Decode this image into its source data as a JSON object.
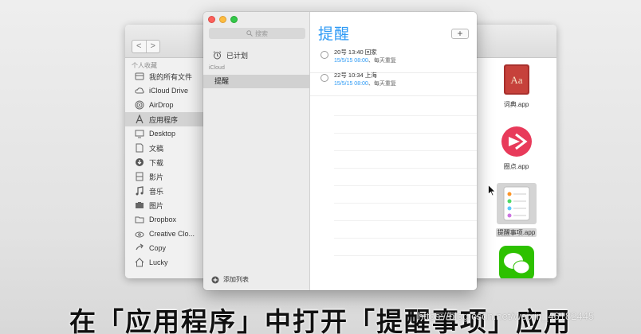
{
  "finder": {
    "nav_back": "<",
    "nav_forward": ">",
    "sidebar_header": "个人收藏",
    "sidebar_items": [
      {
        "label": "我的所有文件",
        "icon": "all-files-icon"
      },
      {
        "label": "iCloud Drive",
        "icon": "cloud-icon"
      },
      {
        "label": "AirDrop",
        "icon": "airdrop-icon"
      },
      {
        "label": "应用程序",
        "icon": "applications-icon",
        "selected": true
      },
      {
        "label": "Desktop",
        "icon": "desktop-icon"
      },
      {
        "label": "文稿",
        "icon": "documents-icon"
      },
      {
        "label": "下载",
        "icon": "download-icon"
      },
      {
        "label": "影片",
        "icon": "movies-icon"
      },
      {
        "label": "音乐",
        "icon": "music-icon"
      },
      {
        "label": "图片",
        "icon": "pictures-icon"
      },
      {
        "label": "Dropbox",
        "icon": "folder-icon"
      },
      {
        "label": "Creative Clo...",
        "icon": "creative-cloud-icon"
      },
      {
        "label": "Copy",
        "icon": "copy-icon"
      },
      {
        "label": "Lucky",
        "icon": "home-icon"
      }
    ],
    "apps": [
      {
        "label": "词典.app",
        "icon": "dictionary-app-icon"
      },
      {
        "label": "圈点.app",
        "icon": "skitch-app-icon"
      },
      {
        "label": "提醒事项.app",
        "icon": "reminders-app-icon",
        "selected": true
      },
      {
        "label": "",
        "icon": "wechat-app-icon"
      }
    ]
  },
  "reminders": {
    "search_placeholder": "搜索",
    "scheduled_label": "已计划",
    "section_icloud": "iCloud",
    "list_name": "提醒",
    "add_list_label": "添加列表",
    "title": "提醒",
    "add_button": "+",
    "items": [
      {
        "title": "20号 13:40 回家",
        "date": "15/5/15 08:00",
        "repeat": "、每天重复"
      },
      {
        "title": "22号 10:34 上海",
        "date": "15/5/15 08:00",
        "repeat": "、每天重复"
      }
    ]
  },
  "caption": "在「应用程序」中打开「提醒事项」应用",
  "watermark": "https://blog.csdn.net/weixin_46182445",
  "colors": {
    "accent_blue": "#2d9af5",
    "traffic_red": "#fc605b",
    "traffic_yellow": "#fdbc40",
    "traffic_green": "#34c84a"
  }
}
